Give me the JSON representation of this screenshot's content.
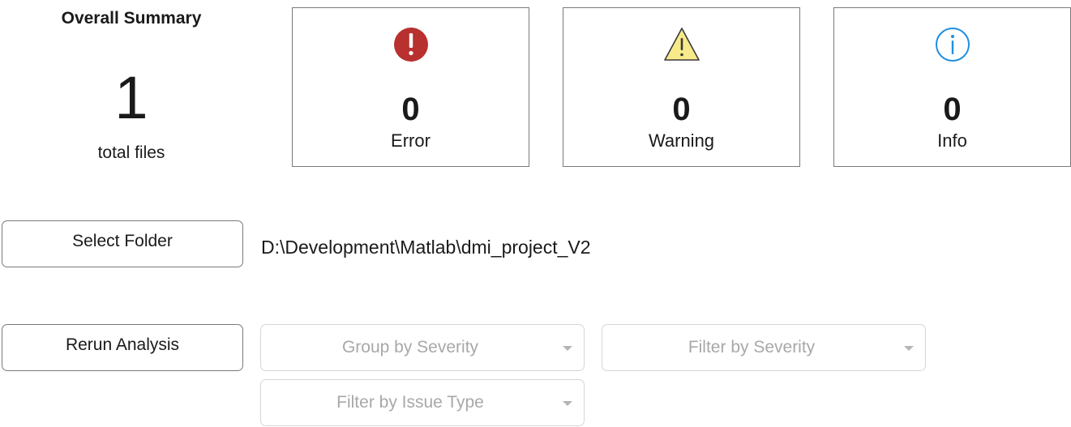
{
  "summary": {
    "title": "Overall Summary",
    "total_count": "1",
    "caption": "total files"
  },
  "cards": {
    "error": {
      "count": "0",
      "label": "Error",
      "icon": "error-icon",
      "color": "#b8312f"
    },
    "warning": {
      "count": "0",
      "label": "Warning",
      "icon": "warning-icon",
      "color": "#f7ea8a"
    },
    "info": {
      "count": "0",
      "label": "Info",
      "icon": "info-icon",
      "color": "#1f8fe0"
    }
  },
  "folder": {
    "button_label": "Select Folder",
    "path": "D:\\Development\\Matlab\\dmi_project_V2"
  },
  "analysis": {
    "rerun_label": "Rerun Analysis"
  },
  "dropdowns": {
    "group_by": "Group by Severity",
    "filter_severity": "Filter by Severity",
    "filter_issue_type": "Filter by Issue Type"
  }
}
